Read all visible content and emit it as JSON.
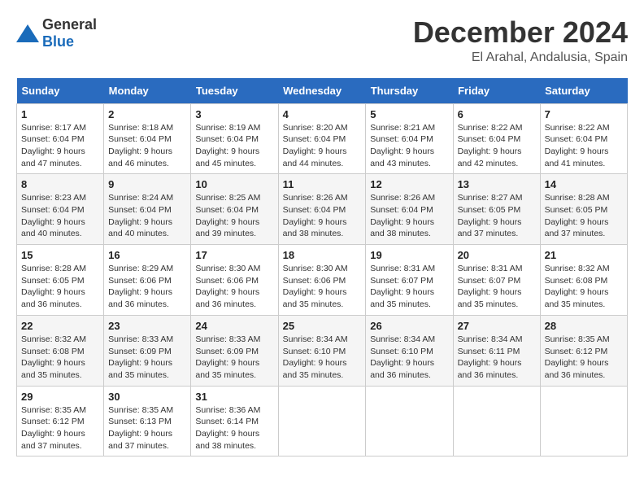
{
  "header": {
    "logo_general": "General",
    "logo_blue": "Blue",
    "month": "December 2024",
    "location": "El Arahal, Andalusia, Spain"
  },
  "days_of_week": [
    "Sunday",
    "Monday",
    "Tuesday",
    "Wednesday",
    "Thursday",
    "Friday",
    "Saturday"
  ],
  "weeks": [
    [
      {
        "day": "1",
        "sunrise": "8:17 AM",
        "sunset": "6:04 PM",
        "daylight": "9 hours and 47 minutes."
      },
      {
        "day": "2",
        "sunrise": "8:18 AM",
        "sunset": "6:04 PM",
        "daylight": "9 hours and 46 minutes."
      },
      {
        "day": "3",
        "sunrise": "8:19 AM",
        "sunset": "6:04 PM",
        "daylight": "9 hours and 45 minutes."
      },
      {
        "day": "4",
        "sunrise": "8:20 AM",
        "sunset": "6:04 PM",
        "daylight": "9 hours and 44 minutes."
      },
      {
        "day": "5",
        "sunrise": "8:21 AM",
        "sunset": "6:04 PM",
        "daylight": "9 hours and 43 minutes."
      },
      {
        "day": "6",
        "sunrise": "8:22 AM",
        "sunset": "6:04 PM",
        "daylight": "9 hours and 42 minutes."
      },
      {
        "day": "7",
        "sunrise": "8:22 AM",
        "sunset": "6:04 PM",
        "daylight": "9 hours and 41 minutes."
      }
    ],
    [
      {
        "day": "8",
        "sunrise": "8:23 AM",
        "sunset": "6:04 PM",
        "daylight": "9 hours and 40 minutes."
      },
      {
        "day": "9",
        "sunrise": "8:24 AM",
        "sunset": "6:04 PM",
        "daylight": "9 hours and 40 minutes."
      },
      {
        "day": "10",
        "sunrise": "8:25 AM",
        "sunset": "6:04 PM",
        "daylight": "9 hours and 39 minutes."
      },
      {
        "day": "11",
        "sunrise": "8:26 AM",
        "sunset": "6:04 PM",
        "daylight": "9 hours and 38 minutes."
      },
      {
        "day": "12",
        "sunrise": "8:26 AM",
        "sunset": "6:04 PM",
        "daylight": "9 hours and 38 minutes."
      },
      {
        "day": "13",
        "sunrise": "8:27 AM",
        "sunset": "6:05 PM",
        "daylight": "9 hours and 37 minutes."
      },
      {
        "day": "14",
        "sunrise": "8:28 AM",
        "sunset": "6:05 PM",
        "daylight": "9 hours and 37 minutes."
      }
    ],
    [
      {
        "day": "15",
        "sunrise": "8:28 AM",
        "sunset": "6:05 PM",
        "daylight": "9 hours and 36 minutes."
      },
      {
        "day": "16",
        "sunrise": "8:29 AM",
        "sunset": "6:06 PM",
        "daylight": "9 hours and 36 minutes."
      },
      {
        "day": "17",
        "sunrise": "8:30 AM",
        "sunset": "6:06 PM",
        "daylight": "9 hours and 36 minutes."
      },
      {
        "day": "18",
        "sunrise": "8:30 AM",
        "sunset": "6:06 PM",
        "daylight": "9 hours and 35 minutes."
      },
      {
        "day": "19",
        "sunrise": "8:31 AM",
        "sunset": "6:07 PM",
        "daylight": "9 hours and 35 minutes."
      },
      {
        "day": "20",
        "sunrise": "8:31 AM",
        "sunset": "6:07 PM",
        "daylight": "9 hours and 35 minutes."
      },
      {
        "day": "21",
        "sunrise": "8:32 AM",
        "sunset": "6:08 PM",
        "daylight": "9 hours and 35 minutes."
      }
    ],
    [
      {
        "day": "22",
        "sunrise": "8:32 AM",
        "sunset": "6:08 PM",
        "daylight": "9 hours and 35 minutes."
      },
      {
        "day": "23",
        "sunrise": "8:33 AM",
        "sunset": "6:09 PM",
        "daylight": "9 hours and 35 minutes."
      },
      {
        "day": "24",
        "sunrise": "8:33 AM",
        "sunset": "6:09 PM",
        "daylight": "9 hours and 35 minutes."
      },
      {
        "day": "25",
        "sunrise": "8:34 AM",
        "sunset": "6:10 PM",
        "daylight": "9 hours and 35 minutes."
      },
      {
        "day": "26",
        "sunrise": "8:34 AM",
        "sunset": "6:10 PM",
        "daylight": "9 hours and 36 minutes."
      },
      {
        "day": "27",
        "sunrise": "8:34 AM",
        "sunset": "6:11 PM",
        "daylight": "9 hours and 36 minutes."
      },
      {
        "day": "28",
        "sunrise": "8:35 AM",
        "sunset": "6:12 PM",
        "daylight": "9 hours and 36 minutes."
      }
    ],
    [
      {
        "day": "29",
        "sunrise": "8:35 AM",
        "sunset": "6:12 PM",
        "daylight": "9 hours and 37 minutes."
      },
      {
        "day": "30",
        "sunrise": "8:35 AM",
        "sunset": "6:13 PM",
        "daylight": "9 hours and 37 minutes."
      },
      {
        "day": "31",
        "sunrise": "8:36 AM",
        "sunset": "6:14 PM",
        "daylight": "9 hours and 38 minutes."
      },
      null,
      null,
      null,
      null
    ]
  ]
}
